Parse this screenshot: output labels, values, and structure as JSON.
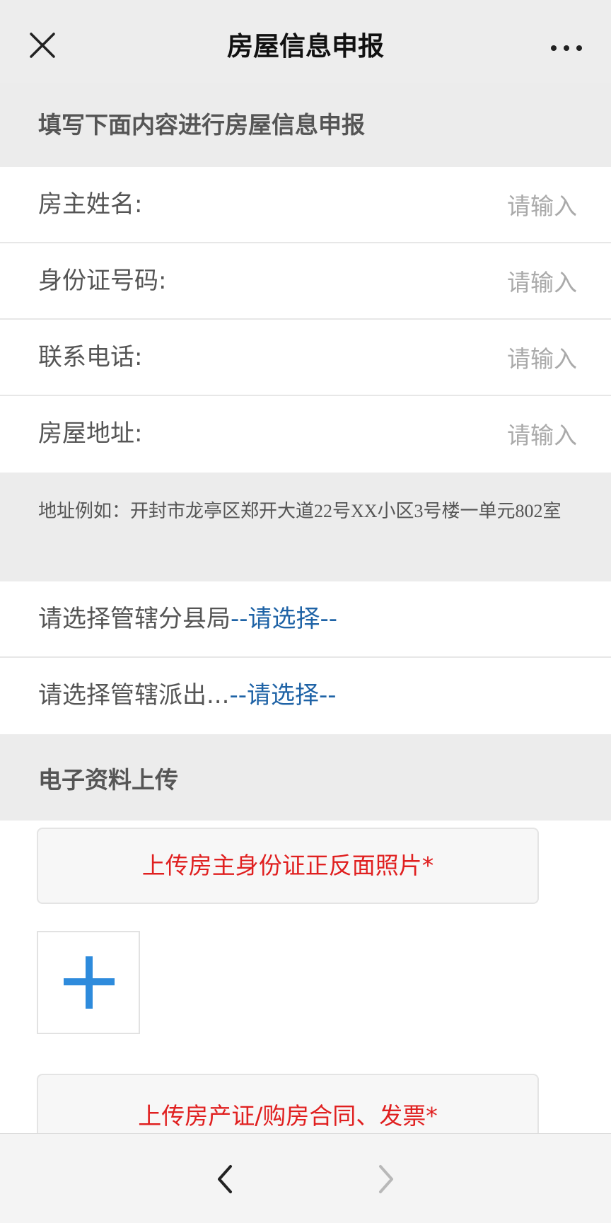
{
  "header": {
    "title": "房屋信息申报",
    "close_icon": "close-icon",
    "more_icon": "more-dots-icon"
  },
  "intro": {
    "title": "填写下面内容进行房屋信息申报"
  },
  "form": {
    "fields": [
      {
        "label": "房主姓名:",
        "placeholder": "请输入",
        "value": ""
      },
      {
        "label": "身份证号码:",
        "placeholder": "请输入",
        "value": ""
      },
      {
        "label": "联系电话:",
        "placeholder": "请输入",
        "value": ""
      },
      {
        "label": "房屋地址:",
        "placeholder": "请输入",
        "value": ""
      }
    ],
    "address_hint": "地址例如：开封市龙亭区郑开大道22号XX小区3号楼一单元802室",
    "selects": [
      {
        "label": "请选择管辖分县局",
        "value": "--请选择--"
      },
      {
        "label": "请选择管辖派出...",
        "value": "--请选择--"
      }
    ]
  },
  "upload": {
    "title": "电子资料上传",
    "id_card_button": "上传房主身份证正反面照片*",
    "property_button": "上传房产证/购房合同、发票*",
    "add_icon": "plus-icon"
  },
  "bottom_nav": {
    "back_icon": "chevron-left-icon",
    "forward_icon": "chevron-right-icon"
  },
  "colors": {
    "accent_link": "#1f63a6",
    "required_red": "#e02020",
    "plus_blue": "#2e8bdc"
  }
}
